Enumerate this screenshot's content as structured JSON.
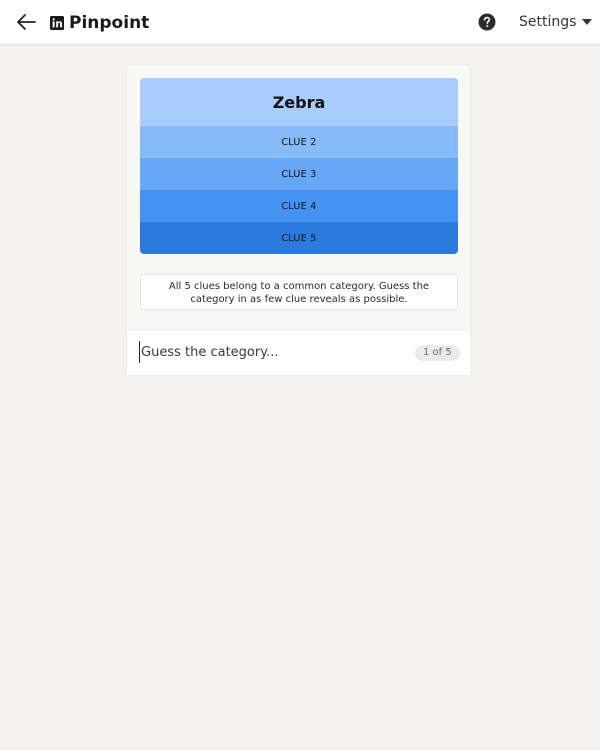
{
  "header": {
    "app_title": "Pinpoint",
    "settings_label": "Settings",
    "icons": {
      "back": "arrow-left-icon",
      "brand": "linkedin-icon",
      "help": "question-circle-icon",
      "settings_caret": "caret-down-icon"
    }
  },
  "game": {
    "clues": [
      {
        "label": "Zebra",
        "revealed": true,
        "color": "#a8cdfc"
      },
      {
        "label": "CLUE 2",
        "revealed": false,
        "color": "#86baf9"
      },
      {
        "label": "CLUE 3",
        "revealed": false,
        "color": "#66a7f6"
      },
      {
        "label": "CLUE 4",
        "revealed": false,
        "color": "#4493f2"
      },
      {
        "label": "CLUE 5",
        "revealed": false,
        "color": "#2a7bdd"
      }
    ],
    "instructions": "All 5 clues belong to a common category. Guess the category in as few clue reveals as possible.",
    "guess_placeholder": "Guess the category...",
    "guess_value": "",
    "counter": "1 of 5"
  },
  "colors": {
    "background": "#f3f2ee",
    "header_bg": "#ffffff",
    "card_bg": "#f8f8f7"
  }
}
